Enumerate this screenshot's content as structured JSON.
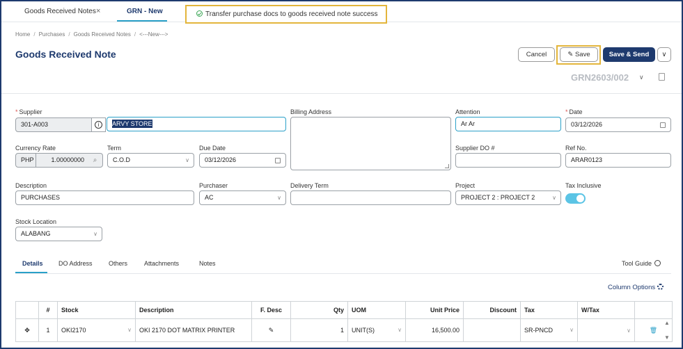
{
  "tabs": [
    {
      "label": "Goods Received Notes",
      "close": "×"
    },
    {
      "label": "GRN - New"
    }
  ],
  "toast": {
    "message": "Transfer purchase docs to goods received note success"
  },
  "breadcrumb": [
    "Home",
    "Purchases",
    "Goods Received Notes",
    "<---New--->"
  ],
  "breadcrumb_sep": "/",
  "header": {
    "title": "Goods Received Note",
    "cancel_label": "Cancel",
    "save_label": "Save",
    "save_send_label": "Save & Send",
    "more_label": "∨",
    "doc_no": "GRN2603/002",
    "doc_chevron": "∨"
  },
  "form": {
    "supplier": {
      "label": "Supplier",
      "code": "301-A003",
      "name": "ARVY STORE",
      "info": "i"
    },
    "billing_address": {
      "label": "Billing Address",
      "value": ""
    },
    "attention": {
      "label": "Attention",
      "value": "Ar Ar"
    },
    "date": {
      "label": "Date",
      "value": "03/12/2026"
    },
    "currency_rate": {
      "label": "Currency Rate",
      "currency": "PHP",
      "rate": "1.00000000"
    },
    "term": {
      "label": "Term",
      "value": "C.O.D"
    },
    "due_date": {
      "label": "Due Date",
      "value": "03/12/2026"
    },
    "supplier_do": {
      "label": "Supplier DO #",
      "value": ""
    },
    "ref_no": {
      "label": "Ref No.",
      "value": "ARAR0123"
    },
    "description": {
      "label": "Description",
      "value": "PURCHASES"
    },
    "purchaser": {
      "label": "Purchaser",
      "value": "AC"
    },
    "delivery_term": {
      "label": "Delivery Term",
      "value": ""
    },
    "project": {
      "label": "Project",
      "value": "PROJECT 2 : PROJECT 2"
    },
    "tax_inclusive": {
      "label": "Tax Inclusive",
      "on": true
    },
    "stock_location": {
      "label": "Stock Location",
      "value": "ALABANG"
    }
  },
  "required_mark": "*",
  "subtabs": [
    "Details",
    "DO Address",
    "Others",
    "Attachments",
    "Notes"
  ],
  "tool_guide": "Tool Guide",
  "column_options": "Column Options",
  "table": {
    "headers": [
      "",
      "#",
      "Stock",
      "Description",
      "F. Desc",
      "Qty",
      "UOM",
      "Unit Price",
      "Discount",
      "Tax",
      "W/Tax",
      ""
    ],
    "rows": [
      {
        "move": "✥",
        "no": "1",
        "stock": "OKI2170",
        "description": "OKI 2170 DOT MATRIX PRINTER",
        "fdesc": "✎",
        "qty": "1",
        "uom": "UNIT(S)",
        "unit_price": "16,500.00",
        "discount": "",
        "tax": "SR-PNCD",
        "wtax": "",
        "delete": "🗑"
      }
    ]
  },
  "colors": {
    "brand": "#1e3a6e",
    "accent": "#2aa0c8",
    "highlight": "#e3b53b",
    "toggle": "#5bc4e5"
  }
}
